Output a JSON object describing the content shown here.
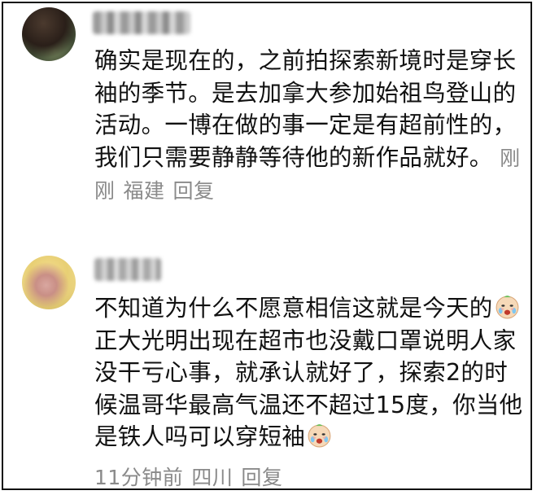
{
  "comments": [
    {
      "text_parts": [
        "确实是现在的，之前拍探索新境时是穿长袖的季节。是去加拿大参加始祖鸟登山的活动。一博在做的事一定是有超前性的，我们只需要静静等待他的新作品就好。"
      ],
      "time": "刚刚",
      "location": "福建",
      "reply": "回复"
    },
    {
      "text_before": "不知道为什么不愿意相信这就是今天的",
      "text_middle": "正大光明出现在超市也没戴口罩说明人家没干亏心事，就承认就好了，探索2的时候温哥华最高气温还不超过15度，你当他是铁人吗可以穿短袖",
      "emoji": "crying-face-emoji",
      "time": "11分钟前",
      "location": "四川",
      "reply": "回复"
    }
  ],
  "colors": {
    "text": "#111111",
    "meta": "#8a8a8a",
    "border": "#111111"
  }
}
